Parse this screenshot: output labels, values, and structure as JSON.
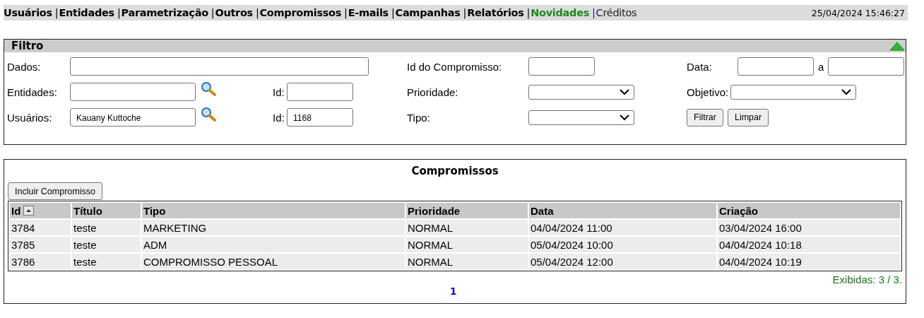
{
  "menu": {
    "separator": "|",
    "items": [
      {
        "label": "Usuários",
        "kind": "bold"
      },
      {
        "label": "Entidades",
        "kind": "bold"
      },
      {
        "label": "Parametrização",
        "kind": "bold"
      },
      {
        "label": "Outros",
        "kind": "bold"
      },
      {
        "label": "Compromissos",
        "kind": "bold"
      },
      {
        "label": "E-mails",
        "kind": "bold"
      },
      {
        "label": "Campanhas",
        "kind": "bold"
      },
      {
        "label": "Relatórios",
        "kind": "bold"
      },
      {
        "label": "Novidades",
        "kind": "highlight"
      },
      {
        "label": "Créditos",
        "kind": "plain"
      }
    ],
    "datetime": "25/04/2024 15:46:27"
  },
  "filter": {
    "title": "Filtro",
    "expanded": true,
    "dados_label": "Dados:",
    "id_compromisso_label": "Id do Compromisso:",
    "data_label": "Data:",
    "data_sep": "a",
    "entidades_label": "Entidades:",
    "entidades_id_label": "Id:",
    "prioridade_label": "Prioridade:",
    "objetivo_label": "Objetivo:",
    "usuarios_label": "Usuários:",
    "usuarios_value": "Kauany Kuttoche",
    "usuarios_id_label": "Id:",
    "usuarios_id_value": "1168",
    "tipo_label": "Tipo:",
    "buttons": [
      "Filtrar",
      "Limpar"
    ]
  },
  "results": {
    "title": "Compromissos",
    "add_button": "Incluir Compromisso",
    "columns": [
      "Id",
      "Título",
      "Tipo",
      "Prioridade",
      "Data",
      "Criação"
    ],
    "rows": [
      [
        "3784",
        "teste",
        "MARKETING",
        "NORMAL",
        "04/04/2024 11:00",
        "03/04/2024 16:00"
      ],
      [
        "3785",
        "teste",
        "ADM",
        "NORMAL",
        "05/04/2024 10:00",
        "04/04/2024 10:18"
      ],
      [
        "3786",
        "teste",
        "COMPROMISSO PESSOAL",
        "NORMAL",
        "05/04/2024 12:00",
        "04/04/2024 10:19"
      ]
    ],
    "count": "Exibidas: 3 / 3.",
    "pages": [
      {
        "label": "1",
        "selected": true
      }
    ]
  }
}
